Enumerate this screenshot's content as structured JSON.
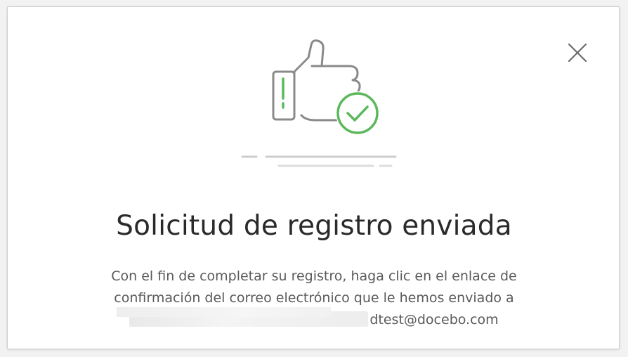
{
  "dialog": {
    "title": "Solicitud de registro enviada",
    "message_line1": "Con el fin de completar su registro, haga clic en el enlace de",
    "message_line2": "confirmación del correo electrónico que le hemos enviado a",
    "email_visible_part": "dtest@docebo.com"
  },
  "icons": {
    "close": "close-icon",
    "illustration": "thumbs-up-check-icon"
  },
  "colors": {
    "accent_green": "#5cb85c",
    "icon_gray": "#8a8a8a",
    "title_text": "#2a2a2a",
    "body_text": "#5a5a5a"
  }
}
